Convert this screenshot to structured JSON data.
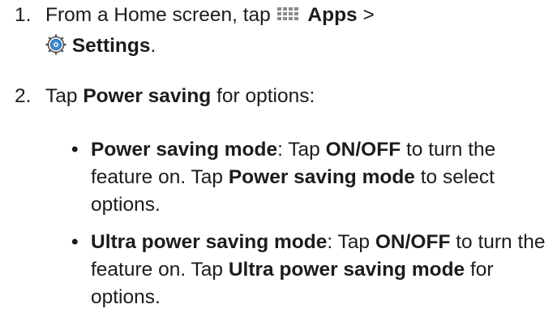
{
  "steps": [
    {
      "number": "1.",
      "part1": "From a Home screen, tap",
      "apps_label": "Apps",
      "separator": ">",
      "settings_label": "Settings",
      "end": "."
    },
    {
      "number": "2.",
      "tap": "Tap",
      "power_saving": "Power saving",
      "rest": "for options:"
    }
  ],
  "bullets": [
    {
      "term": "Power saving mode",
      "colon": ": Tap",
      "onoff": "ON/OFF",
      "mid": "to turn the feature on. Tap",
      "term2": "Power saving mode",
      "end": "to select options."
    },
    {
      "term": "Ultra power saving mode",
      "colon": ": Tap",
      "onoff": "ON/OFF",
      "mid": "to turn the feature on. Tap",
      "term2": "Ultra power saving mode",
      "end": "for options."
    }
  ]
}
